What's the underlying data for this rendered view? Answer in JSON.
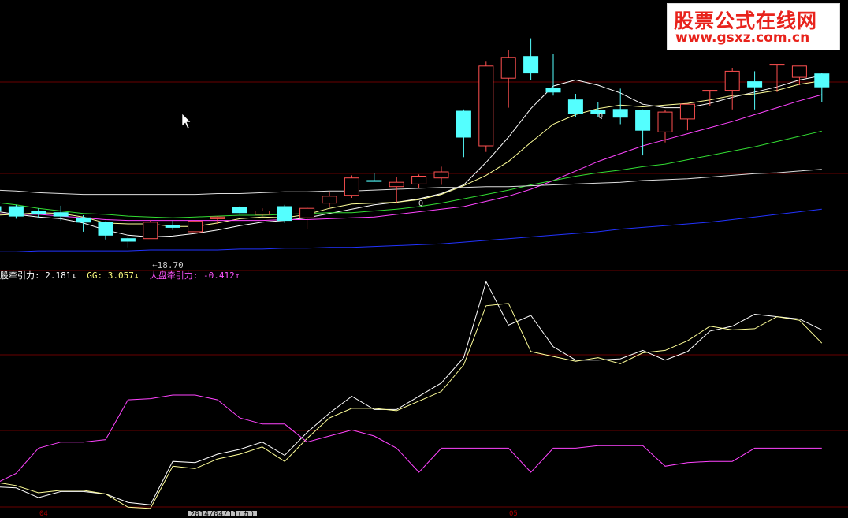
{
  "watermark": {
    "title": "股票公式在线网",
    "url": "www.gsxz.com.cn"
  },
  "price_chart": {
    "low_marker": "←18.70",
    "q_marks": [
      "Q",
      "Q"
    ]
  },
  "indicator_legend": [
    {
      "label": "股牵引力:",
      "value": "2.181",
      "arrow": "↓",
      "color": "#ffffff"
    },
    {
      "label": "GG:",
      "value": "3.057",
      "arrow": "↓",
      "color": "#ffff80"
    },
    {
      "label": "大盘牵引力:",
      "value": "-0.412",
      "arrow": "↑",
      "color": "#ff55ff"
    }
  ],
  "x_axis": {
    "date_label": "2014/04/11(五)",
    "left_tick": "04",
    "mid_tick": "05"
  },
  "colors": {
    "up": "#ff5050",
    "down": "#54ffff",
    "ma_white": "#ffffff",
    "ma_yellow": "#ffff99",
    "ma_magenta": "#ff44ff",
    "ma_green": "#33dd33",
    "ma_gray": "#dddddd",
    "ma_blue": "#2233ff",
    "grid": "#6a0000"
  },
  "chart_data": [
    {
      "type": "candlestick",
      "candles": [
        {
          "o": 40,
          "c": 36,
          "h": 44,
          "l": 27
        },
        {
          "o": 40,
          "c": 29,
          "h": 42,
          "l": 26
        },
        {
          "o": 35,
          "c": 32,
          "h": 38,
          "l": 27
        },
        {
          "o": 33,
          "c": 29,
          "h": 41,
          "l": 24
        },
        {
          "o": 27,
          "c": 22,
          "h": 30,
          "l": 11
        },
        {
          "o": 22,
          "c": 7,
          "h": 23,
          "l": 2
        },
        {
          "o": 3,
          "c": 0,
          "h": 5,
          "l": -7
        },
        {
          "o": 3,
          "c": 22,
          "h": 24,
          "l": 3
        },
        {
          "o": 18,
          "c": 16,
          "h": 24,
          "l": 13
        },
        {
          "o": 11,
          "c": 23,
          "h": 24,
          "l": 9
        },
        {
          "o": 26,
          "c": 28,
          "h": 29,
          "l": 20
        },
        {
          "o": 39,
          "c": 33,
          "h": 41,
          "l": 30
        },
        {
          "o": 31,
          "c": 35,
          "h": 38,
          "l": 29
        },
        {
          "o": 40,
          "c": 24,
          "h": 42,
          "l": 21
        },
        {
          "o": 27,
          "c": 38,
          "h": 40,
          "l": 14
        },
        {
          "o": 44,
          "c": 52,
          "h": 57,
          "l": 39
        },
        {
          "o": 53,
          "c": 73,
          "h": 76,
          "l": 50
        },
        {
          "o": 70,
          "c": 69,
          "h": 79,
          "l": 69
        },
        {
          "o": 63,
          "c": 68,
          "h": 74,
          "l": 44
        },
        {
          "o": 66,
          "c": 75,
          "h": 77,
          "l": 61
        },
        {
          "o": 73,
          "c": 80,
          "h": 86,
          "l": 65
        },
        {
          "o": 150,
          "c": 120,
          "h": 152,
          "l": 97
        },
        {
          "o": 110,
          "c": 202,
          "h": 207,
          "l": 103
        },
        {
          "o": 188,
          "c": 212,
          "h": 220,
          "l": 154
        },
        {
          "o": 213,
          "c": 194,
          "h": 234,
          "l": 186
        },
        {
          "o": 176,
          "c": 172,
          "h": 216,
          "l": 168
        },
        {
          "o": 163,
          "c": 147,
          "h": 170,
          "l": 143
        },
        {
          "o": 151,
          "c": 147,
          "h": 160,
          "l": 143
        },
        {
          "o": 152,
          "c": 143,
          "h": 176,
          "l": 135
        },
        {
          "o": 151,
          "c": 128,
          "h": 152,
          "l": 99
        },
        {
          "o": 126,
          "c": 149,
          "h": 151,
          "l": 114
        },
        {
          "o": 141,
          "c": 158,
          "h": 158,
          "l": 128
        },
        {
          "o": 174,
          "c": 174,
          "h": 174,
          "l": 156
        },
        {
          "o": 174,
          "c": 196,
          "h": 200,
          "l": 152
        },
        {
          "o": 184,
          "c": 178,
          "h": 196,
          "l": 152
        },
        {
          "o": 204,
          "c": 204,
          "h": 204,
          "l": 172
        },
        {
          "o": 189,
          "c": 202,
          "h": 202,
          "l": 180
        },
        {
          "o": 193,
          "c": 178,
          "h": 194,
          "l": 160
        }
      ],
      "moving_averages": [
        {
          "color_key": "ma_white",
          "values": [
            35,
            31,
            28,
            26,
            21,
            13,
            7,
            5,
            6,
            9,
            13,
            18,
            22,
            24,
            27,
            32,
            37,
            42,
            45,
            49,
            55,
            65,
            91,
            120,
            153,
            179,
            186,
            180,
            171,
            158,
            154,
            154,
            159,
            166,
            172,
            178,
            186,
            191
          ]
        },
        {
          "color_key": "ma_yellow",
          "values": [
            30,
            31,
            33,
            32,
            28,
            21,
            20,
            20,
            17,
            17,
            21,
            26,
            28,
            27,
            31,
            38,
            43,
            44,
            45,
            48,
            54,
            64,
            76,
            92,
            114,
            135,
            146,
            153,
            157,
            155,
            157,
            159,
            163,
            168,
            170,
            174,
            181,
            185
          ]
        },
        {
          "color_key": "ma_magenta",
          "values": [
            32,
            31,
            31,
            29,
            27,
            25,
            24,
            24,
            24,
            24,
            24,
            24,
            24,
            25,
            25,
            26,
            27,
            28,
            31,
            34,
            37,
            40,
            46,
            52,
            60,
            70,
            81,
            92,
            101,
            110,
            117,
            124,
            131,
            138,
            146,
            154,
            162,
            169
          ]
        },
        {
          "color_key": "ma_green",
          "values": [
            45,
            42,
            38,
            35,
            32,
            31,
            29,
            28,
            27,
            28,
            29,
            30,
            30,
            31,
            32,
            33,
            33,
            35,
            37,
            40,
            44,
            49,
            54,
            59,
            65,
            70,
            75,
            79,
            82,
            86,
            89,
            94,
            99,
            104,
            109,
            115,
            121,
            127
          ]
        },
        {
          "color_key": "ma_gray",
          "values": [
            59,
            58,
            56,
            55,
            54,
            54,
            54,
            54,
            54,
            54,
            55,
            55,
            56,
            57,
            57,
            58,
            58,
            59,
            60,
            61,
            62,
            62,
            63,
            63,
            64,
            65,
            66,
            67,
            68,
            70,
            71,
            72,
            74,
            76,
            78,
            79,
            81,
            83
          ]
        },
        {
          "color_key": "ma_blue",
          "values": [
            -12,
            -12,
            -11,
            -11,
            -11,
            -11,
            -11,
            -10,
            -10,
            -10,
            -10,
            -9,
            -9,
            -8,
            -8,
            -7,
            -7,
            -6,
            -5,
            -4,
            -3,
            -1,
            1,
            3,
            5,
            7,
            9,
            11,
            14,
            16,
            18,
            20,
            22,
            25,
            28,
            31,
            34,
            37
          ]
        }
      ]
    },
    {
      "type": "line",
      "series": [
        {
          "name": "股牵引力",
          "color_key": "ma_white",
          "values": [
            -27,
            -28,
            -36,
            -31,
            -31,
            -33,
            -40,
            -42,
            -6,
            -7,
            0,
            4,
            10,
            -1,
            18,
            34,
            48,
            37,
            37,
            48,
            59,
            80,
            143,
            107,
            115,
            89,
            78,
            78,
            79,
            86,
            78,
            85,
            102,
            106,
            116,
            114,
            112,
            103
          ]
        },
        {
          "name": "GG",
          "color_key": "ma_yellow",
          "values": [
            -23,
            -26,
            -32,
            -30,
            -30,
            -33,
            -44,
            -45,
            -10,
            -12,
            -4,
            0,
            6,
            -6,
            13,
            30,
            38,
            38,
            36,
            44,
            52,
            74,
            123,
            125,
            85,
            81,
            77,
            80,
            75,
            84,
            86,
            94,
            106,
            103,
            104,
            114,
            111,
            92
          ]
        },
        {
          "name": "大盘牵引力",
          "color_key": "ma_magenta",
          "values": [
            -25,
            -16,
            5,
            10,
            10,
            12,
            45,
            46,
            49,
            49,
            45,
            30,
            25,
            25,
            10,
            15,
            20,
            15,
            5,
            -15,
            5,
            5,
            5,
            5,
            -15,
            5,
            5,
            7,
            7,
            7,
            -10,
            -7,
            -6,
            -6,
            5,
            5,
            5,
            5
          ]
        }
      ]
    }
  ]
}
